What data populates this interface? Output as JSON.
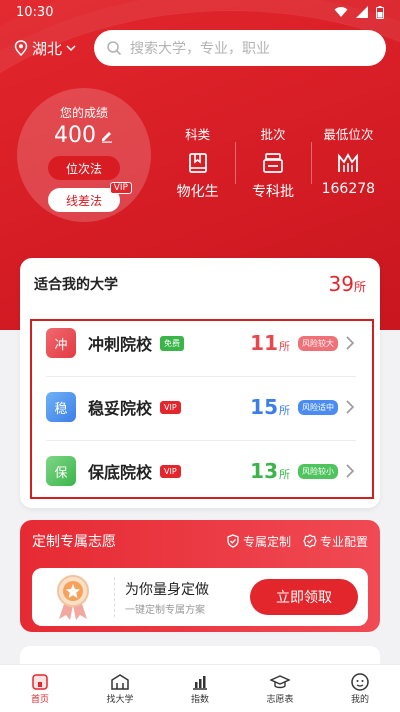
{
  "status": {
    "time": "10:30"
  },
  "location": {
    "province": "湖北"
  },
  "search": {
    "placeholder": "搜索大学，专业，职业"
  },
  "score": {
    "label": "您的成绩",
    "value": "400",
    "rank_btn": "位次法",
    "line_btn": "线差法",
    "vip": "VIP"
  },
  "stats": [
    {
      "title": "科类",
      "value": "物化生",
      "icon": "book-icon"
    },
    {
      "title": "批次",
      "value": "专科批",
      "icon": "layers-icon"
    },
    {
      "title": "最低位次",
      "value": "166278",
      "icon": "rank-icon"
    }
  ],
  "suitable": {
    "title": "适合我的大学",
    "count": "39",
    "unit": "所",
    "rows": [
      {
        "badge": "冲",
        "name": "冲刺院校",
        "tag": "免费",
        "count": "11",
        "unit": "所",
        "risk": "风险较大",
        "color": "#e8474f",
        "tag_color": "#3bb54a",
        "risk_color": "#f07077"
      },
      {
        "badge": "稳",
        "name": "稳妥院校",
        "tag": "VIP",
        "count": "15",
        "unit": "所",
        "risk": "风险适中",
        "color": "#3c7ee8",
        "tag_color": "#e3262c",
        "risk_color": "#4a8cf0"
      },
      {
        "badge": "保",
        "name": "保底院校",
        "tag": "VIP",
        "count": "13",
        "unit": "所",
        "risk": "风险较小",
        "color": "#3bb54a",
        "tag_color": "#e3262c",
        "risk_color": "#4fc45e"
      }
    ]
  },
  "custom": {
    "title": "定制专属志愿",
    "feature1": "专属定制",
    "feature2": "专业配置",
    "headline": "为你量身定做",
    "sub": "一键定制专属方案",
    "button": "立即领取"
  },
  "tabs": [
    {
      "label": "首页",
      "icon": "home-icon"
    },
    {
      "label": "找大学",
      "icon": "building-icon"
    },
    {
      "label": "指数",
      "icon": "chart-icon"
    },
    {
      "label": "志愿表",
      "icon": "cap-icon"
    },
    {
      "label": "我的",
      "icon": "user-icon"
    }
  ],
  "colors": {
    "brand": "#e3262c"
  }
}
